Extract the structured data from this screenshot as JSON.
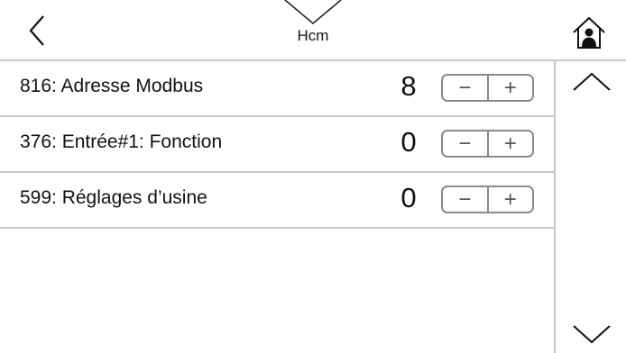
{
  "header": {
    "title": "Hcm"
  },
  "rows": [
    {
      "label": "816: Adresse Modbus",
      "value": "8",
      "minus": "−",
      "plus": "+"
    },
    {
      "label": "376: Entrée#1: Fonction",
      "value": "0",
      "minus": "−",
      "plus": "+"
    },
    {
      "label": "599: Réglages d’usine",
      "value": "0",
      "minus": "−",
      "plus": "+"
    }
  ],
  "icons": {
    "back": "chevron-left-icon",
    "menu_tab": "chevron-down-icon",
    "home": "home-user-icon",
    "scroll_up": "chevron-up-icon",
    "scroll_down": "chevron-down-icon"
  }
}
